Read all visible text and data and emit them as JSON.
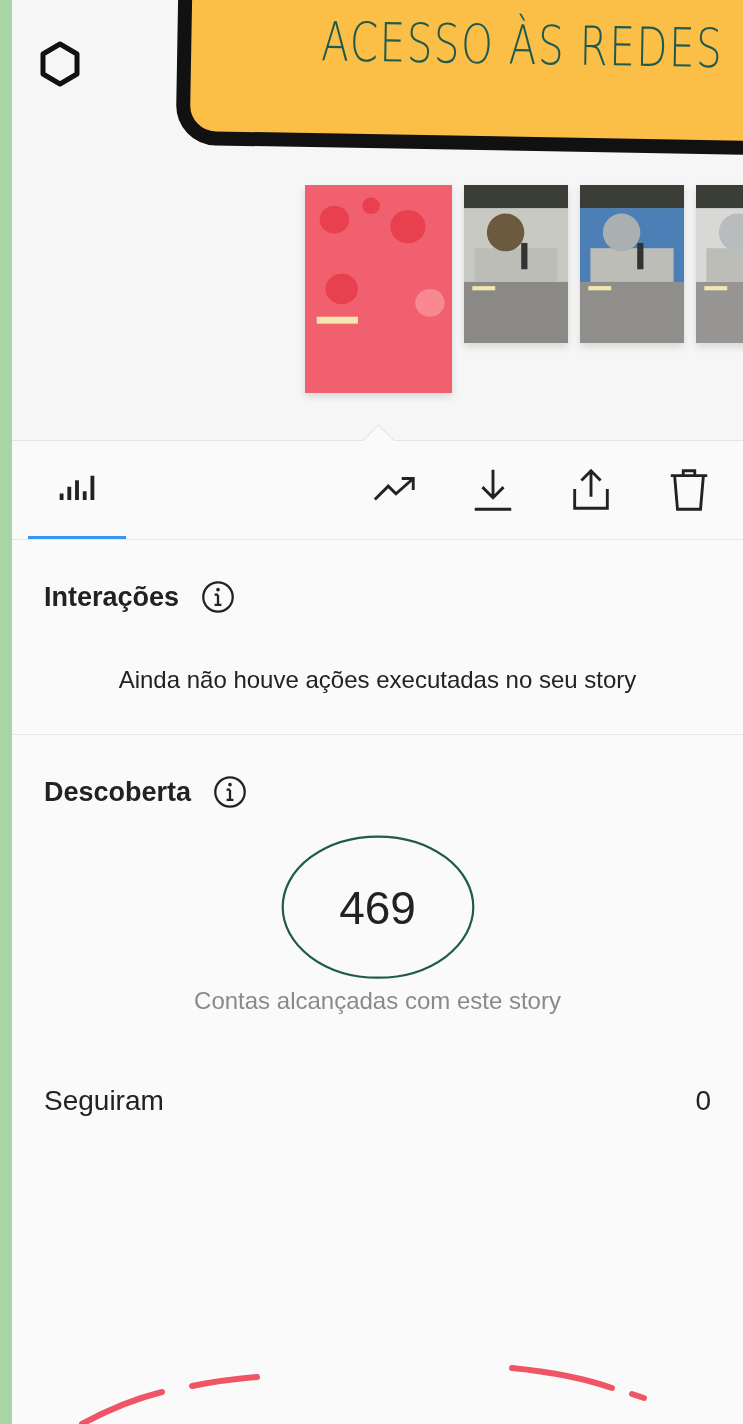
{
  "banner": {
    "title": "ACESSO ÀS REDES"
  },
  "stories": [
    {
      "kind": "picture",
      "selected": true
    },
    {
      "kind": "picture",
      "selected": false
    },
    {
      "kind": "picture",
      "selected": false
    },
    {
      "kind": "picture",
      "selected": false
    }
  ],
  "tabs": [
    {
      "selected": true
    }
  ],
  "interactions": {
    "title": "Interações",
    "message": "Ainda não houve ações executadas no seu story"
  },
  "discovery": {
    "title": "Descoberta",
    "value": "469",
    "circled": true,
    "caption": "Contas alcançadas com este story",
    "rows": [
      {
        "label": "Seguiram",
        "value": "0"
      }
    ]
  }
}
